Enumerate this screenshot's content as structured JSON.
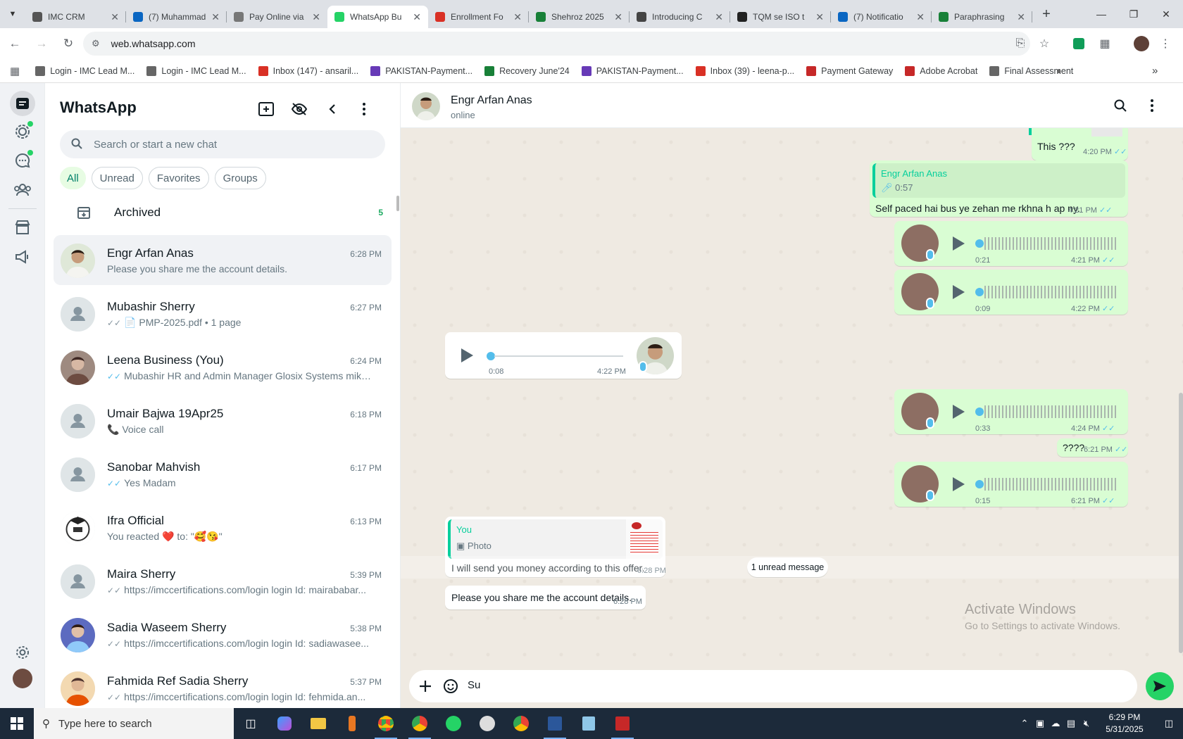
{
  "browser": {
    "tabs": [
      {
        "label": "IMC CRM",
        "color": "#555"
      },
      {
        "label": "(7) Muhammad",
        "color": "#0a66c2"
      },
      {
        "label": "Pay Online via",
        "color": "#777"
      },
      {
        "label": "WhatsApp Bu",
        "color": "#25d366"
      },
      {
        "label": "Enrollment Fo",
        "color": "#d93025"
      },
      {
        "label": "Shehroz 2025",
        "color": "#188038"
      },
      {
        "label": "Introducing C",
        "color": "#444"
      },
      {
        "label": "TQM se ISO t",
        "color": "#222"
      },
      {
        "label": "(7) Notificatio",
        "color": "#0a66c2"
      },
      {
        "label": "Paraphrasing",
        "color": "#188038"
      }
    ],
    "active_tab": 3,
    "url": "web.whatsapp.com",
    "bookmarks": [
      {
        "label": "Login - IMC Lead M...",
        "color": "#666"
      },
      {
        "label": "Login - IMC Lead M...",
        "color": "#666"
      },
      {
        "label": "Inbox (147) - ansaril...",
        "color": "#d93025"
      },
      {
        "label": "PAKISTAN-Payment...",
        "color": "#673ab7"
      },
      {
        "label": "Recovery June'24",
        "color": "#188038"
      },
      {
        "label": "PAKISTAN-Payment...",
        "color": "#673ab7"
      },
      {
        "label": "Inbox (39) - leena-p...",
        "color": "#d93025"
      },
      {
        "label": "Payment Gateway",
        "color": "#c62828"
      },
      {
        "label": "Adobe Acrobat",
        "color": "#c62828"
      },
      {
        "label": "Final Assessment",
        "color": "#666"
      }
    ]
  },
  "sidebar": {
    "title": "WhatsApp",
    "search_placeholder": "Search or start a new chat",
    "filters": [
      "All",
      "Unread",
      "Favorites",
      "Groups"
    ],
    "active_filter": "All",
    "archived_label": "Archived",
    "archived_count": "5",
    "chats": [
      {
        "name": "Engr Arfan Anas",
        "time": "6:28 PM",
        "tick": "",
        "message": "Please you share me the account details.",
        "avatar": "photo-man"
      },
      {
        "name": "Mubashir Sherry",
        "time": "6:27 PM",
        "tick": "grey",
        "message": "📄 PMP-2025.pdf • 1 page",
        "avatar": "placeholder"
      },
      {
        "name": "Leena Business (You)",
        "time": "6:24 PM",
        "tick": "blue",
        "message": "Mubashir HR and Admin Manager Glosix Systems mike...",
        "avatar": "photo-woman"
      },
      {
        "name": "Umair Bajwa 19Apr25",
        "time": "6:18 PM",
        "tick": "",
        "message": "📞 Voice call",
        "avatar": "placeholder"
      },
      {
        "name": "Sanobar Mahvish",
        "time": "6:17 PM",
        "tick": "blue",
        "message": "Yes Madam",
        "avatar": "placeholder"
      },
      {
        "name": "Ifra Official",
        "time": "6:13 PM",
        "tick": "",
        "message": "You reacted ❤️ to: \"🥰😘\"",
        "avatar": "logo"
      },
      {
        "name": "Maira Sherry",
        "time": "5:39 PM",
        "tick": "grey",
        "message": "https://imccertifications.com/login login Id: mairababar...",
        "avatar": "placeholder"
      },
      {
        "name": "Sadia Waseem Sherry",
        "time": "5:38 PM",
        "tick": "grey",
        "message": "https://imccertifications.com/login login Id: sadiawasee...",
        "avatar": "photo-girl"
      },
      {
        "name": "Fahmida Ref Sadia Sherry",
        "time": "5:37 PM",
        "tick": "grey",
        "message": "https://imccertifications.com/login login Id: fehmida.an...",
        "avatar": "photo-woman2"
      }
    ]
  },
  "conversation": {
    "contact_name": "Engr Arfan Anas",
    "status": "online",
    "messages": {
      "m1_text": "This ???",
      "m1_time": "4:20 PM",
      "m2_quote_name": "Engr Arfan Anas",
      "m2_quote_sub": "0:57",
      "m2_text": "Self paced hai bus ye zehan me rkhna h ap ny.",
      "m2_time": "4:21 PM",
      "v1_dur": "0:21",
      "v1_time": "4:21 PM",
      "v2_dur": "0:09",
      "v2_time": "4:22 PM",
      "v3_dur": "0:08",
      "v3_time": "4:22 PM",
      "v4_dur": "0:33",
      "v4_time": "4:24 PM",
      "m3_text": "????",
      "m3_time": "6:21 PM",
      "v5_dur": "0:15",
      "v5_time": "6:21 PM",
      "m4_quote_name": "You",
      "m4_quote_sub": "Photo",
      "m4_text": "I will send you money according to this offer.",
      "m4_time": "6:28 PM",
      "unread_label": "1 unread message",
      "m5_text": "Please you share me the account details.",
      "m5_time": "6:28 PM"
    },
    "composer_value": "Su"
  },
  "watermark": {
    "line1": "Activate Windows",
    "line2": "Go to Settings to activate Windows."
  },
  "taskbar": {
    "search_placeholder": "Type here to search",
    "time": "6:29 PM",
    "date": "5/31/2025"
  },
  "colors": {
    "accent": "#25d366",
    "outgoing_bubble": "#d9fdd3",
    "read_tick": "#53bdeb"
  }
}
